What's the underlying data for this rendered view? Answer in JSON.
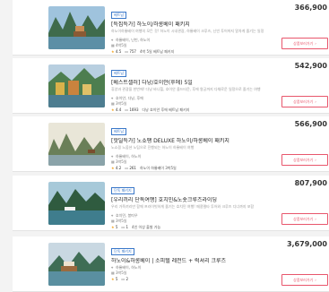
{
  "products": [
    {
      "badge": "베트남",
      "title": "[특집특가] 하노이/하롱베이 패키지",
      "desc": "하노이하롱베이 여행의 모든 것! 하노이 시내관광, 하롱베이 크루즈, 닌빈 투어까지 알차게 즐기는 일정",
      "route": "하롱베이, 닌빈, 하노이",
      "days": "4박5일",
      "rating": "4.5",
      "reviews": "757",
      "extra": "4박 5일 베트남 패키지",
      "price": "366,900",
      "cta": "상품보러가기"
    },
    {
      "badge": "베트남",
      "title": "[베스트셀러] 다낭/호이안(후에) 5일",
      "desc": "휴양과 관광을 한번에! 다낭 바나힐, 호이안 올드타운, 후에 왕궁까지 다채로운 일정으로 즐기는 여행",
      "route": "호이안, 다낭, 후에",
      "days": "3박5일",
      "rating": "4.4",
      "reviews": "1693",
      "extra": "다낭 호이안 후에 베트남 패키지",
      "price": "542,900",
      "cta": "상품보러가기"
    },
    {
      "badge": "베트남",
      "title": "[핫딜특가] 노쇼팽 DELUXE 하노이/하롱베이 패키지",
      "desc": "노쇼핑 노옵션 노팁으로 진행되는 하노이 하롱베이 여행",
      "route": "하롱베이, 하노이",
      "days": "3박5일",
      "rating": "4.2",
      "reviews": "261",
      "extra": "하노이 하롱베이 3박5일",
      "price": "566,900",
      "cta": "상품보러가기"
    },
    {
      "badge": "단독 패키지",
      "title": "[우리끼리 단독여행] 호치민&노숏크루즈라이딩",
      "desc": "우리 가족끼리만 함께 프라이빗하게 즐기는 호치민 여행! 메콩델타 투어와 크루즈 디너까지 포함",
      "route": "호치민, 붕따우",
      "days": "3박5일",
      "rating": "5",
      "reviews": "1",
      "extra": "4인 이상 출발 가능",
      "price": "807,900",
      "cta": "상품보러가기"
    },
    {
      "badge": "단독 패키지",
      "title": "하노이&하롱베이 | 소피텔 레전드 + 럭셔리 크루즈",
      "desc": "",
      "route": "하롱베이, 하노이",
      "days": "3박5일",
      "rating": "5",
      "reviews": "2",
      "extra": "",
      "price": "3,679,000",
      "cta": "상품보러가기"
    }
  ],
  "icons": {
    "pin": "map-pin-icon",
    "calendar": "calendar-icon",
    "star": "star-icon",
    "chat": "review-icon",
    "chevron": "chevron-right-icon"
  },
  "colors": {
    "accent": "#e8566c",
    "badge": "#3a78c9",
    "star": "#f5a623"
  }
}
